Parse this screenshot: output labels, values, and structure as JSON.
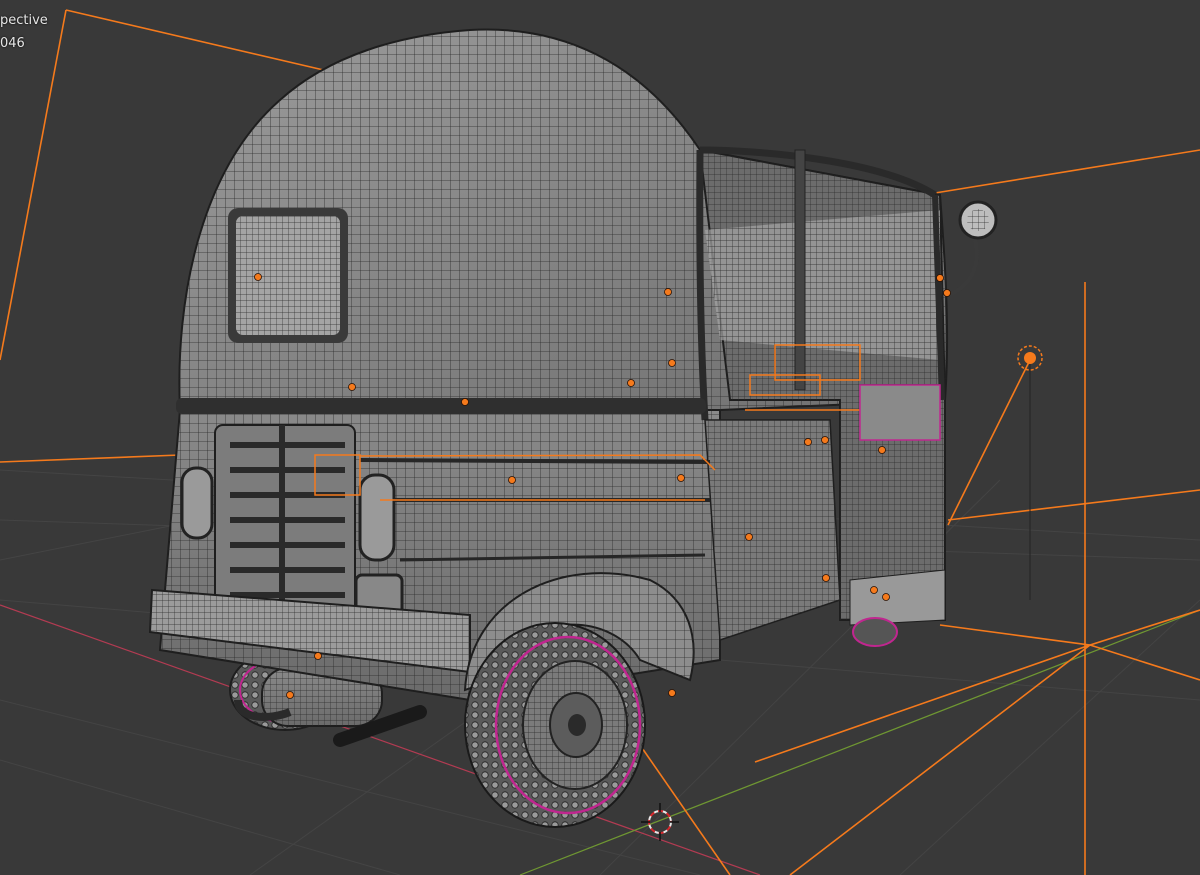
{
  "viewport": {
    "view_mode": "pective",
    "object_info": "046"
  },
  "colors": {
    "background": "#393939",
    "grid_line": "#434343",
    "x_axis": "#b33b52",
    "y_axis": "#6f9732",
    "selection_orange": "#f57a1c",
    "mesh_fill": "#8f8f8f",
    "wire": "#2b2b2b",
    "tire_seam": "#c0268f"
  },
  "icons": [
    "3d-cursor-icon",
    "light-icon",
    "origin-dot-icon"
  ]
}
